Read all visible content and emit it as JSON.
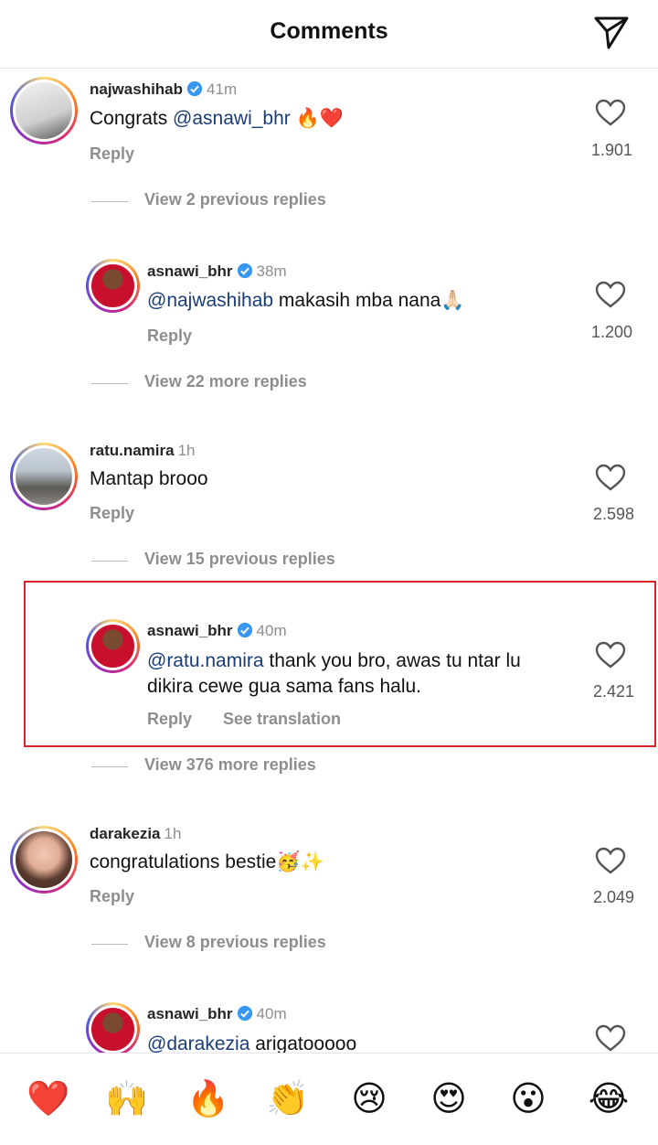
{
  "header": {
    "title": "Comments",
    "send_icon": "paper-plane-icon"
  },
  "comments": [
    {
      "username": "najwashihab",
      "verified": true,
      "time": "41m",
      "mention": "",
      "text": "Congrats ",
      "text_mention": "@asnawi_bhr",
      "text_after": " 🔥❤️",
      "reply": "Reply",
      "likes": "1.901"
    },
    {
      "username": "asnawi_bhr",
      "verified": true,
      "time": "38m",
      "mention": "@najwashihab",
      "text": " makasih mba nana🙏🏻",
      "reply": "Reply",
      "likes": "1.200"
    },
    {
      "username": "ratu.namira",
      "verified": false,
      "time": "1h",
      "text": "Mantap brooo",
      "reply": "Reply",
      "likes": "2.598"
    },
    {
      "username": "asnawi_bhr",
      "verified": true,
      "time": "40m",
      "mention": "@ratu.namira",
      "text_line1": " thank you bro, awas tu ntar lu",
      "text_line2": "dikira cewe gua sama fans halu.",
      "reply": "Reply",
      "see_translation": "See translation",
      "likes": "2.421"
    },
    {
      "username": "darakezia",
      "verified": false,
      "time": "1h",
      "text": "congratulations bestie🥳✨",
      "reply": "Reply",
      "likes": "2.049"
    },
    {
      "username": "asnawi_bhr",
      "verified": true,
      "time": "40m",
      "mention": "@darakezia",
      "text": " arigatooooo"
    }
  ],
  "view_replies": [
    "View 2 previous replies",
    "View 22 more replies",
    "View 15 previous replies",
    "View 376 more replies",
    "View 8 previous replies"
  ],
  "emoji_bar": [
    "❤️",
    "🙌",
    "🔥",
    "👏",
    "😢",
    "😍",
    "😮",
    "😂"
  ],
  "colors": {
    "mention": "#1a3d7a",
    "highlight_border": "#d9232a",
    "verified": "#3897f0"
  }
}
